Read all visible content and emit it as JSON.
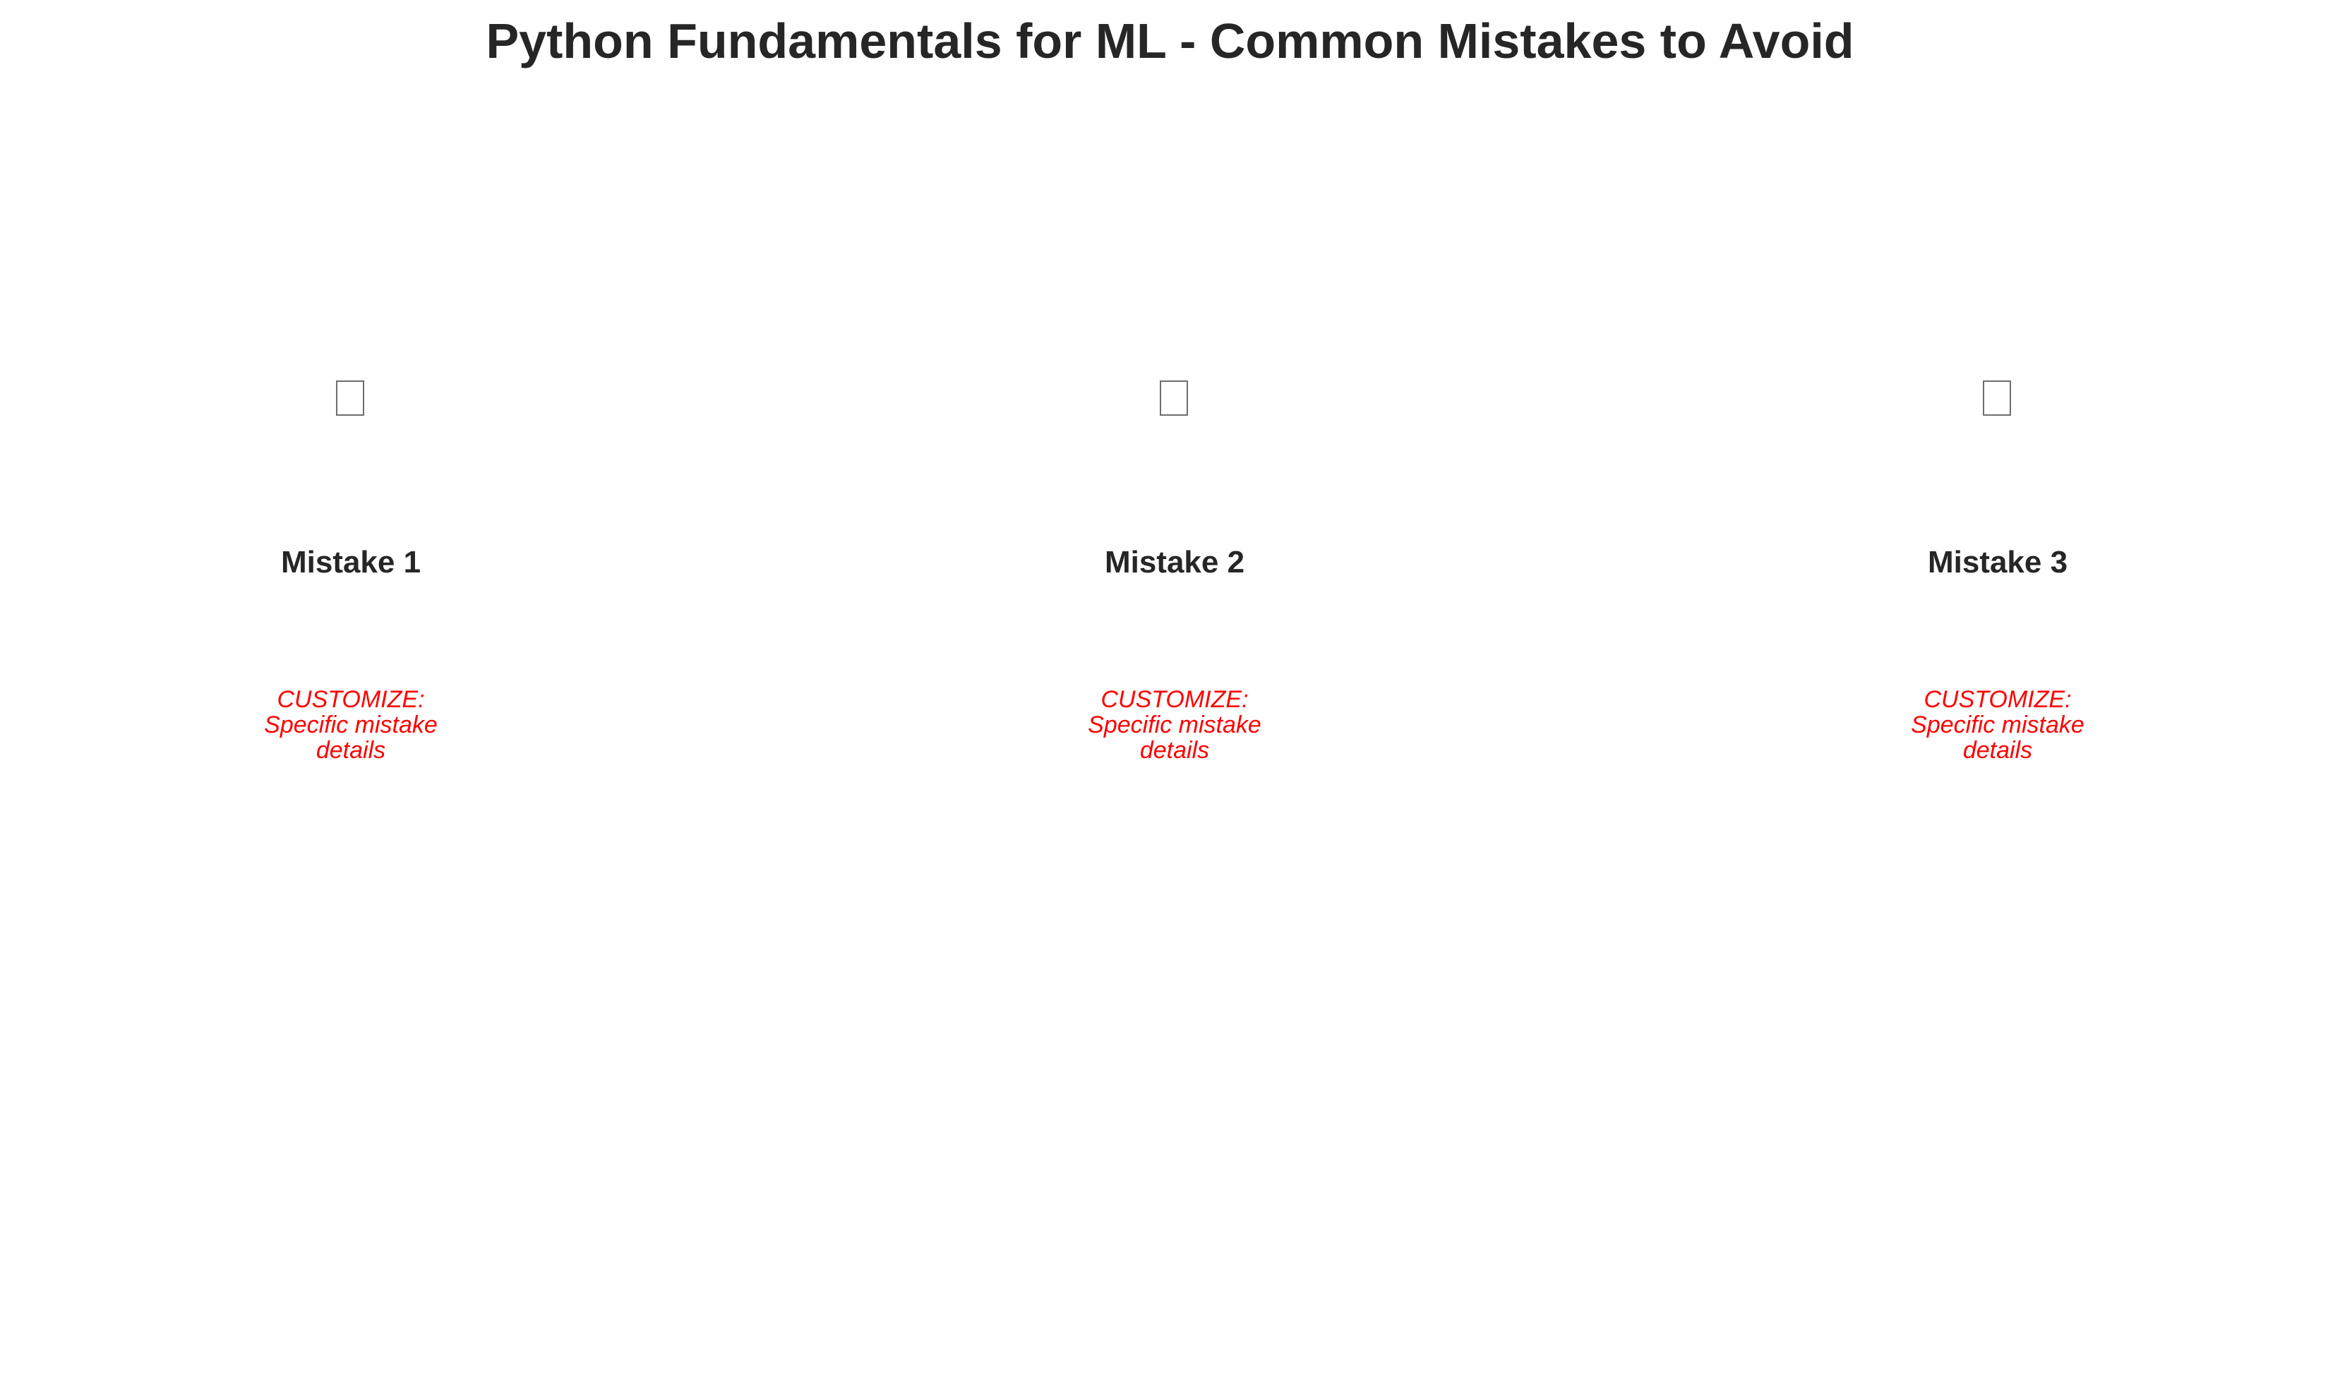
{
  "title": "Python Fundamentals for ML - Common Mistakes to Avoid",
  "colors": {
    "heading": "#262626",
    "note": "#ff0000",
    "icon_outline": "#6e6e6e",
    "background": "#ffffff"
  },
  "mistakes": [
    {
      "icon": "missing-glyph-icon",
      "label": "Mistake 1",
      "note_lines": [
        "CUSTOMIZE:",
        "Specific mistake",
        "details"
      ]
    },
    {
      "icon": "missing-glyph-icon",
      "label": "Mistake 2",
      "note_lines": [
        "CUSTOMIZE:",
        "Specific mistake",
        "details"
      ]
    },
    {
      "icon": "missing-glyph-icon",
      "label": "Mistake 3",
      "note_lines": [
        "CUSTOMIZE:",
        "Specific mistake",
        "details"
      ]
    }
  ]
}
